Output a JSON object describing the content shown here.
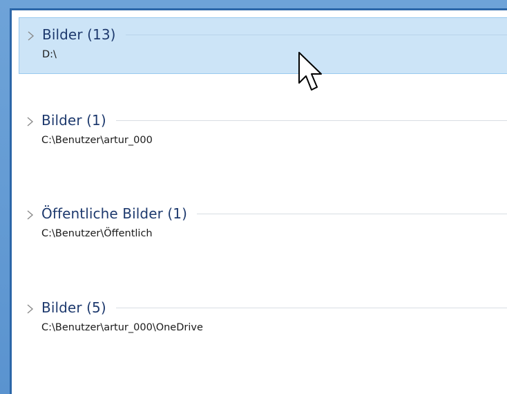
{
  "groups": [
    {
      "title": "Bilder (13)",
      "path": "D:\\",
      "selected": true
    },
    {
      "title": "Bilder (1)",
      "path": "C:\\Benutzer\\artur_000",
      "selected": false
    },
    {
      "title": "Öffentliche Bilder (1)",
      "path": "C:\\Benutzer\\Öffentlich",
      "selected": false
    },
    {
      "title": "Bilder (5)",
      "path": "C:\\Benutzer\\artur_000\\OneDrive",
      "selected": false
    }
  ],
  "colors": {
    "selection_fill": "#cce4f7",
    "selection_border": "#99c9ef",
    "title_text": "#1e3a6e",
    "window_border": "#2b66a8"
  },
  "icons": {
    "expand": "chevron-right-icon",
    "pointer": "mouse-pointer-icon"
  }
}
